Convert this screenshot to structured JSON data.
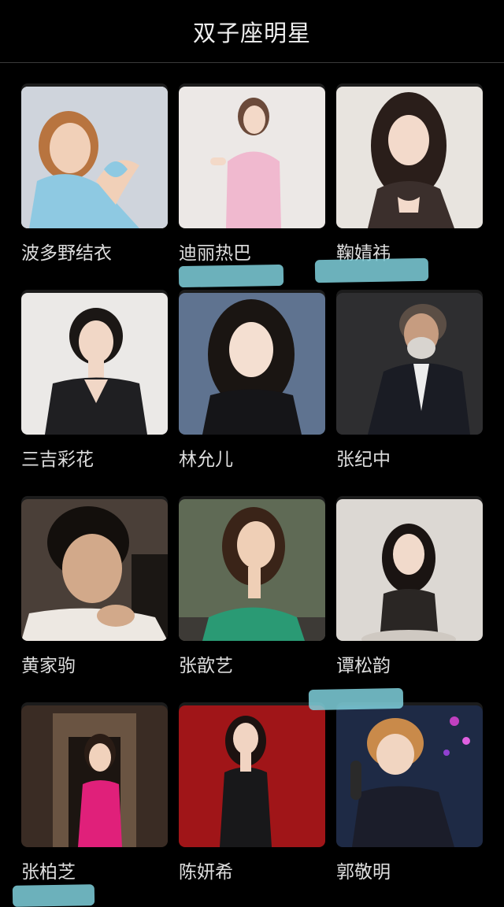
{
  "header": {
    "title": "双子座明星"
  },
  "colors": {
    "background": "#000000",
    "text": "#dedede",
    "divider": "#3a3a3a",
    "smudge": "#7fd0dc"
  },
  "celebrities": [
    {
      "name": "波多野结衣"
    },
    {
      "name": "迪丽热巴"
    },
    {
      "name": "鞠婧祎"
    },
    {
      "name": "三吉彩花"
    },
    {
      "name": "林允儿"
    },
    {
      "name": "张纪中"
    },
    {
      "name": "黄家驹"
    },
    {
      "name": "张歆艺"
    },
    {
      "name": "谭松韵"
    },
    {
      "name": "张柏芝"
    },
    {
      "name": "陈妍希"
    },
    {
      "name": "郭敬明"
    }
  ]
}
